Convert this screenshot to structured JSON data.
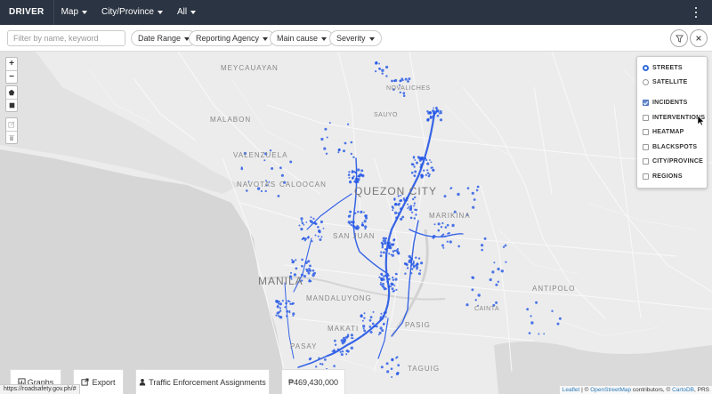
{
  "navbar": {
    "brand": "DRIVER",
    "menus": [
      {
        "label": "Map"
      },
      {
        "label": "City/Province"
      },
      {
        "label": "All"
      }
    ]
  },
  "filters": {
    "search_placeholder": "Filter by name, keyword",
    "dropdowns": [
      {
        "label": "Date Range"
      },
      {
        "label": "Reporting Agency"
      },
      {
        "label": "Main cause"
      },
      {
        "label": "Severity"
      }
    ]
  },
  "map": {
    "place_labels": {
      "meycauayan": "MEYCAUAYAN",
      "malabon": "MALABON",
      "valenzuela": "VALENZUELA",
      "caloocan": "CALOOCAN",
      "navotas": "NAVOTAS",
      "quezon_city": "QUEZON CITY",
      "marikina": "MARIKINA",
      "san_juan": "SAN JUAN",
      "manila": "MANILA",
      "mandaluyong": "MANDALUYONG",
      "makati": "MAKATI",
      "pasig": "PASIG",
      "pasay": "PASAY",
      "taguig": "TAGUIG",
      "antipolo": "ANTIPOLO",
      "cainta": "CAINTA",
      "sauyo": "SAUYO",
      "novaliches": "NOVALICHES"
    },
    "incident_color": "#2356e6"
  },
  "layers": {
    "base": [
      {
        "label": "STREETS",
        "selected": true
      },
      {
        "label": "SATELLITE",
        "selected": false
      }
    ],
    "overlays": [
      {
        "label": "INCIDENTS",
        "checked": true
      },
      {
        "label": "INTERVENTIONS",
        "checked": false
      },
      {
        "label": "HEATMAP",
        "checked": false
      },
      {
        "label": "BLACKSPOTS",
        "checked": false
      },
      {
        "label": "CITY/PROVINCE",
        "checked": false
      },
      {
        "label": "REGIONS",
        "checked": false
      }
    ]
  },
  "bottom": {
    "graphs": "Graphs",
    "export": "Export",
    "assignments": "Traffic Enforcement Assignments",
    "amount": "₱469,430,000"
  },
  "status_url": "https://roadsafety.gov.ph/#",
  "attribution": {
    "leaflet": "Leaflet",
    "sep1": " | © ",
    "osm": "OpenStreetMap",
    "contrib": " contributors, © ",
    "carto": "CartoDB",
    "tail": ", PRS"
  }
}
